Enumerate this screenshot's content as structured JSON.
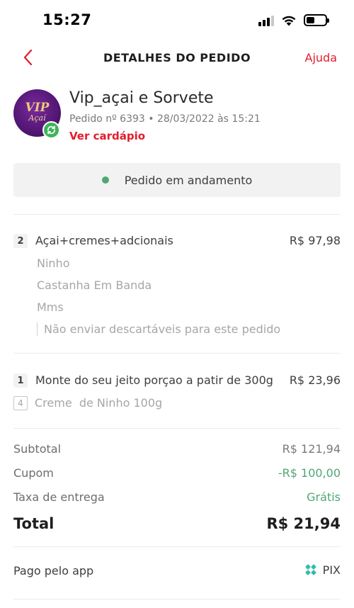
{
  "status_bar": {
    "time": "15:27"
  },
  "header": {
    "title": "DETALHES DO PEDIDO",
    "help_label": "Ajuda"
  },
  "store": {
    "logo_text_top": "VIP",
    "logo_text_bottom": "Açaí",
    "name": "Vip_açai e Sorvete",
    "order_meta": "Pedido nº 6393 • 28/03/2022 às 15:21",
    "menu_link": "Ver cardápio"
  },
  "order_status": {
    "text": "Pedido em andamento",
    "dot_color": "#50a773"
  },
  "items": [
    {
      "qty": "2",
      "name": "Açai+cremes+adcionais",
      "price": "R$ 97,98",
      "addons": [
        "Ninho",
        "Castanha Em Banda",
        "Mms"
      ],
      "note": "Não enviar descartáveis para este pedido"
    },
    {
      "qty": "1",
      "name": "Monte do seu jeito porçao a patir de 300g",
      "price": "R$ 23,96",
      "sub_items": [
        {
          "qty": "4",
          "name": "Creme  de Ninho 100g"
        }
      ]
    }
  ],
  "totals": {
    "subtotal_label": "Subtotal",
    "subtotal_value": "R$ 121,94",
    "coupon_label": "Cupom",
    "coupon_value": "-R$ 100,00",
    "delivery_label": "Taxa de entrega",
    "delivery_value": "Grátis",
    "total_label": "Total",
    "total_value": "R$ 21,94"
  },
  "payment": {
    "label": "Pago pelo app",
    "method": "PIX",
    "method_icon": "pix-icon"
  },
  "colors": {
    "accent": "#e31b2b",
    "success": "#50a773",
    "card_bg": "#f2f2f2"
  }
}
